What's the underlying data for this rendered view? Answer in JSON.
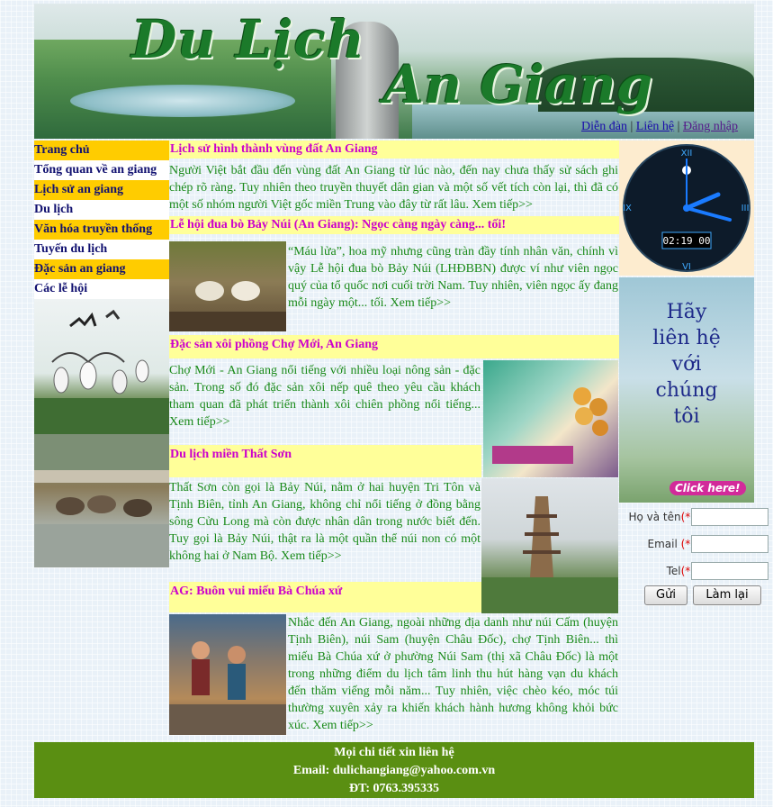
{
  "header": {
    "title_part1": "Du Lịch",
    "title_part2": "An Giang",
    "links": [
      {
        "label": "Diễn đàn"
      },
      {
        "label": "Liên hệ"
      },
      {
        "label": "Đăng nhập"
      }
    ],
    "separator": "|"
  },
  "menu": {
    "items": [
      {
        "label": "Trang chủ",
        "style": "yellow"
      },
      {
        "label": "Tổng quan về an giang",
        "style": "white"
      },
      {
        "label": "Lịch sử an giang",
        "style": "yellow"
      },
      {
        "label": "Du lịch",
        "style": "white"
      },
      {
        "label": "Văn hóa truyền thống",
        "style": "yellow"
      },
      {
        "label": "Tuyến du lịch",
        "style": "white"
      },
      {
        "label": "Đặc sản an giang",
        "style": "yellow"
      },
      {
        "label": "Các lễ hội",
        "style": "white"
      }
    ]
  },
  "articles": [
    {
      "title": "Lịch sử hình thành vùng đất An Giang",
      "text": "Người Việt bắt đầu đến vùng đất An Giang từ lúc nào, đến nay chưa thấy sử sách ghi chép rõ ràng. Tuy nhiên theo truyền thuyết dân gian và một số vết tích còn lại, thì đã có một số nhóm người Việt gốc miền Trung vào đây từ rất lâu. Xem tiếp>>"
    },
    {
      "title": "Lễ hội đua bò Bảy Núi (An Giang): Ngọc càng ngày càng... tối!",
      "text": "“Máu lửa”, hoa mỹ nhưng cũng tràn đầy tính nhân văn, chính vì vậy Lễ hội đua bò Bảy Núi (LHĐBBN) được ví như viên ngọc quý của tổ quốc nơi cuối trời Nam. Tuy nhiên, viên ngọc ấy đang mỗi ngày một... tối. Xem tiếp>>"
    },
    {
      "title": "Đặc sản xôi phồng Chợ Mới, An Giang",
      "text": "Chợ Mới - An Giang nổi tiếng với nhiều loại nông sản - đặc sản. Trong số đó đặc sản xôi nếp quê theo yêu cầu khách tham quan đã phát triển thành xôi chiên phồng nổi tiếng... Xem tiếp>>"
    },
    {
      "title": "Du lịch miền Thất Sơn",
      "text": "Thất Sơn còn gọi là Bảy Núi, nằm ở hai huyện Tri Tôn và Tịnh Biên, tỉnh An Giang, không chỉ nổi tiếng ở đồng bằng sông Cửu Long mà còn được nhân dân trong nước biết đến. Tuy gọi là Bảy Núi, thật ra là một quần thể núi non có một không hai ở Nam Bộ. Xem tiếp>>"
    },
    {
      "title": "AG: Buôn vui miếu Bà Chúa xứ",
      "text": "Nhắc đến An Giang, ngoài những địa danh như núi Cấm (huyện Tịnh Biên), núi Sam (huyện Châu Đốc), chợ Tịnh Biên... thì miếu Bà Chúa xứ ở phường Núi Sam (thị xã Châu Đốc) là một trong những điểm du lịch tâm linh thu hút hàng vạn du khách đến thăm viếng mỗi năm... Tuy nhiên, việc chèo kéo, móc túi thường xuyên xảy ra khiến khách hành hương không khỏi bức xúc. Xem tiếp>>"
    }
  ],
  "clock": {
    "time": "02:19 00",
    "numerals": [
      "XII",
      "III",
      "VI",
      "IX"
    ]
  },
  "ad": {
    "lines": [
      "Hãy",
      "liên hệ",
      "với",
      "chúng tôi"
    ],
    "click_label": "Click here!"
  },
  "form": {
    "fields": [
      {
        "label": "Họ và tên",
        "required": "(*)"
      },
      {
        "label": "Email",
        "required": "(*)"
      },
      {
        "label": "Tel",
        "required": "(*)"
      }
    ],
    "submit_label": "Gửi",
    "reset_label": "Làm lại"
  },
  "footer": {
    "line1": "Mọi chi tiết xin liên hệ",
    "line2": "Email: dulichangiang@yahoo.com.vn",
    "line3": "ĐT: 0763.395335"
  },
  "colors": {
    "menu_yellow": "#ffcc00",
    "heading_bg": "#ffff99",
    "heading_text": "#cc00cc",
    "body_text": "#1a8a1a",
    "footer_bg": "#5a8f12",
    "clock_face": "#0d1b2a",
    "clock_hands": "#1a7bff"
  }
}
